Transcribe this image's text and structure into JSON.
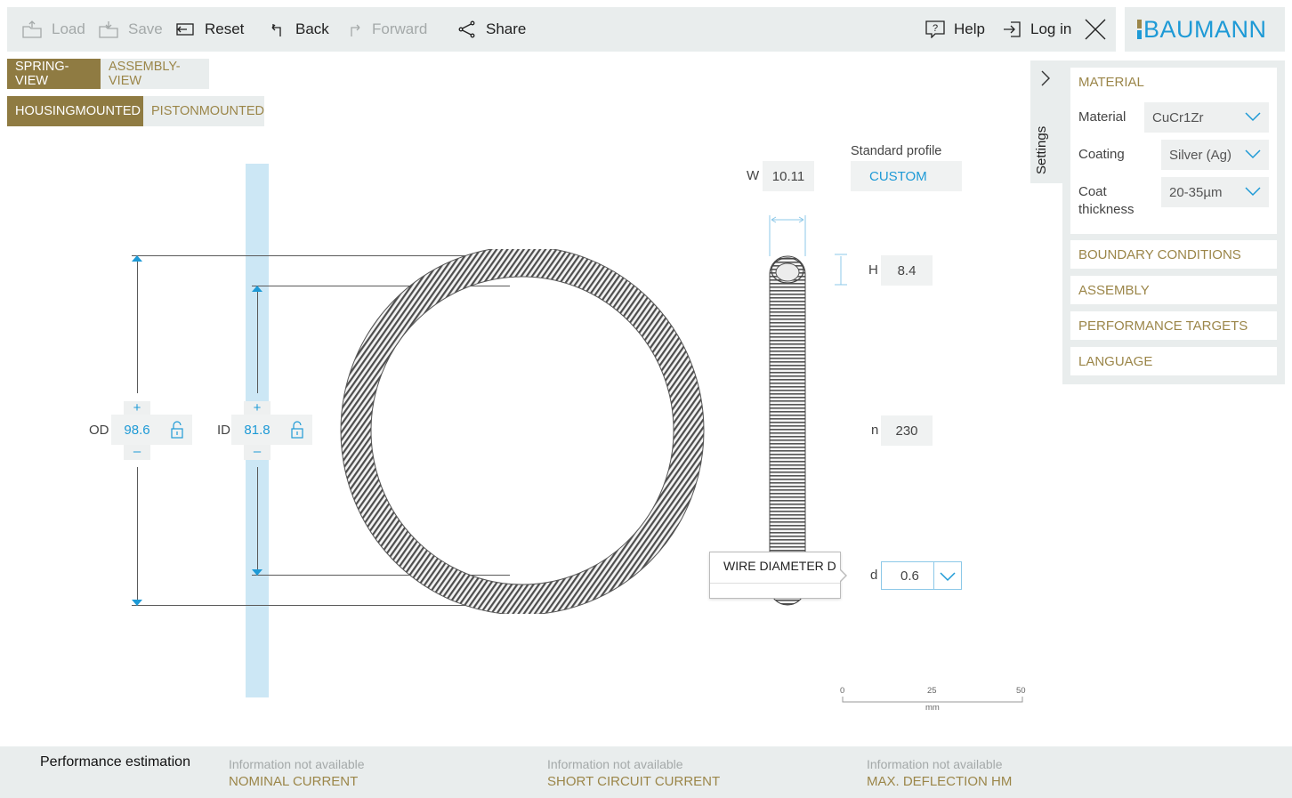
{
  "toolbar": {
    "load": "Load",
    "save": "Save",
    "reset": "Reset",
    "back": "Back",
    "forward": "Forward",
    "share": "Share",
    "help": "Help",
    "login": "Log in"
  },
  "brand": {
    "name": "BAUMANN",
    "accent": "#1e9ad6",
    "gold": "#9b8649"
  },
  "view_tabs": [
    {
      "label": "SPRING-VIEW",
      "active": true
    },
    {
      "label": "ASSEMBLY-VIEW",
      "active": false
    }
  ],
  "mount_tabs": [
    {
      "label": "HOUSINGMOUNTED",
      "active": true
    },
    {
      "label": "PISTONMOUNTED",
      "active": false
    }
  ],
  "dimensions": {
    "od": {
      "label": "OD",
      "value": "98.6",
      "plus": "+",
      "minus": "–"
    },
    "id": {
      "label": "ID",
      "value": "81.8",
      "plus": "+",
      "minus": "–"
    },
    "w": {
      "label": "W",
      "value": "10.11"
    },
    "h": {
      "label": "H",
      "value": "8.4"
    },
    "n": {
      "label": "n",
      "value": "230"
    },
    "d": {
      "label": "d",
      "value": "0.6"
    }
  },
  "profile": {
    "label": "Standard profile",
    "value": "CUSTOM"
  },
  "tooltip": {
    "text": "WIRE DIAMETER D"
  },
  "scale": {
    "ticks": [
      "0",
      "25",
      "50"
    ],
    "unit": "mm"
  },
  "settings": {
    "tab_label": "Settings",
    "sections": {
      "material": "MATERIAL",
      "boundary": "BOUNDARY CONDITIONS",
      "assembly": "ASSEMBLY",
      "performance": "PERFORMANCE TARGETS",
      "language": "LANGUAGE"
    },
    "fields": {
      "material": {
        "label": "Material",
        "value": "CuCr1Zr"
      },
      "coating": {
        "label": "Coating",
        "value": "Silver (Ag)"
      },
      "thickness": {
        "label": "Coat thickness",
        "value": "20-35µm"
      }
    }
  },
  "performance": {
    "title": "Performance estimation",
    "items": [
      {
        "status": "Information not available",
        "name": "NOMINAL CURRENT"
      },
      {
        "status": "Information not available",
        "name": "SHORT CIRCUIT CURRENT"
      },
      {
        "status": "Information not available",
        "name": "MAX. DEFLECTION HM"
      }
    ]
  }
}
